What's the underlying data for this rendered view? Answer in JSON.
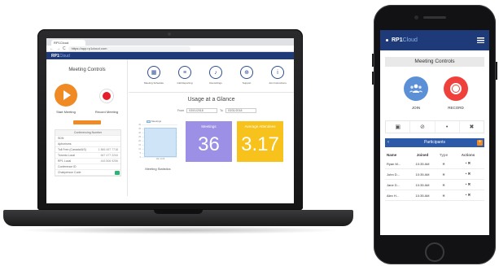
{
  "laptop": {
    "browser": {
      "tab_title": "RP1Cloud",
      "url": "https://app.rp1cloud.com",
      "nav_back": "←",
      "nav_forward": "→",
      "nav_reload": "C"
    },
    "app_header": {
      "logo_main": "RP1",
      "logo_sub": "Cloud"
    },
    "meeting_controls": {
      "title": "Meeting Controls",
      "start_label": "Start Meeting",
      "record_label": "Record Meeting"
    },
    "info_table": {
      "header": "Conferencing Number",
      "rows": [
        {
          "label": "SDN",
          "value": ""
        },
        {
          "label": "Aphorisms",
          "value": ""
        },
        {
          "label": "Toll Free (Canada/US)",
          "value": "1 866 457 7718"
        },
        {
          "label": "Toronto Local",
          "value": "647 477 2244"
        },
        {
          "label": "RP1 Local",
          "value": "416 506 9256"
        },
        {
          "label": "Conference ID",
          "value": ""
        },
        {
          "label": "Chairperson Code",
          "value": ""
        }
      ]
    },
    "quick_icons": [
      {
        "icon": "calendar-icon",
        "glyph": "▦",
        "label": "Meeting Schedule"
      },
      {
        "icon": "bar-chart-icon",
        "glyph": "≡",
        "label": "Call Reporting"
      },
      {
        "icon": "speaker-icon",
        "glyph": "♪",
        "label": "Recordings"
      },
      {
        "icon": "lifebuoy-icon",
        "glyph": "⊕",
        "label": "Support"
      },
      {
        "icon": "info-icon",
        "glyph": "i",
        "label": "Join Instructions"
      }
    ],
    "usage": {
      "title": "Usage at a Glance",
      "from_label": "From",
      "from_value": "03/01/2018",
      "to_label": "To",
      "to_value": "03/31/2018"
    },
    "tiles": {
      "meetings_title": "Meetings",
      "meetings_value": "36",
      "avg_title": "Average Attendees",
      "avg_value": "3.17"
    },
    "chart_data": {
      "type": "bar",
      "title": "Meeting Statistics",
      "series": [
        {
          "name": "Meetings",
          "values": [
            36
          ]
        }
      ],
      "categories": [
        "Mar 2018"
      ],
      "y_ticks": [
        "40",
        "35",
        "30",
        "25",
        "20",
        "15",
        "10",
        "5",
        "0"
      ],
      "ylim": [
        0,
        40
      ],
      "grid": true,
      "legend": "top"
    }
  },
  "phone": {
    "logo_main": "RP1",
    "logo_sub": "Cloud",
    "menu_icon": "hamburger-menu-icon",
    "meeting_controls_title": "Meeting Controls",
    "join_label": "JOIN",
    "record_label": "RECORD",
    "controls": [
      {
        "icon": "lock-icon",
        "glyph": "▣"
      },
      {
        "icon": "mute-all-icon",
        "glyph": "⊘"
      },
      {
        "icon": "mic-icon",
        "glyph": "•"
      },
      {
        "icon": "close-icon",
        "glyph": "✖"
      }
    ],
    "participants_title": "Participants",
    "add_glyph": "+",
    "back_glyph": "‹",
    "columns": [
      "Name",
      "Joined",
      "Type",
      "Actions"
    ],
    "rows": [
      {
        "name": "Ryan M...",
        "joined": "10:35 AM",
        "type": "✱",
        "actions": "•  ✖"
      },
      {
        "name": "John D...",
        "joined": "10:35 AM",
        "type": "✱",
        "actions": "•  ✖"
      },
      {
        "name": "Jane D...",
        "joined": "10:35 AM",
        "type": "✱",
        "actions": "•  ✖"
      },
      {
        "name": "Alex H...",
        "joined": "10:35 AM",
        "type": "✱",
        "actions": "•  ✖"
      }
    ]
  },
  "colors": {
    "header_blue": "#1e3a78",
    "start_orange": "#f08a24",
    "record_red": "#e41e2a",
    "meetings_tile": "#9b8fe6",
    "avg_tile": "#f6c21b",
    "join_blue": "#5b8fd6",
    "participants_bar": "#2d5aa8"
  }
}
